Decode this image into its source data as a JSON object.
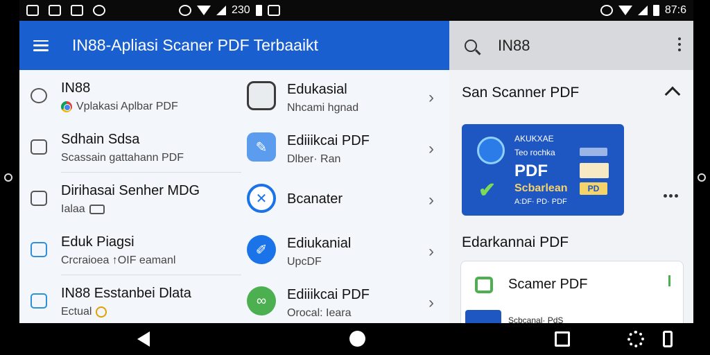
{
  "status_bar": {
    "center_time": "230",
    "right_time": "87:6"
  },
  "app_bar": {
    "title": "IN88-Apliasi Scaner PDF Terbaaikt"
  },
  "left_list": [
    {
      "title": "IN88",
      "subtitle": "Vplakasi Aplbar PDF",
      "icon": "refresh-icon"
    },
    {
      "title": "Sdhain Sdsa",
      "subtitle": "Scassain gattahann PDF",
      "icon": "scan-frame-icon"
    },
    {
      "title": "Dirihasai Senher MDG",
      "subtitle": "Ialaa",
      "icon": "photo-scan-icon"
    },
    {
      "title": "Eduk Piagsi",
      "subtitle": "Crcraioea ↑OIF eamanl",
      "icon": "building-icon"
    },
    {
      "title": "IN88 Esstanbei Dlata",
      "subtitle": "Ectual",
      "icon": "bank-icon"
    }
  ],
  "right_list": [
    {
      "title": "Edukasial",
      "subtitle": "Nhcami hgnad",
      "icon": "document-icon",
      "color": "#3a3a3a"
    },
    {
      "title": "Ediiikcai PDF",
      "subtitle": "Dlber· Ran",
      "icon": "edit-icon",
      "color": "#4a8fe8"
    },
    {
      "title": "Bcanater",
      "subtitle": "",
      "icon": "compass-icon",
      "color": "#1a73e8"
    },
    {
      "title": "Ediukanial",
      "subtitle": "UpcDF",
      "icon": "pen-icon",
      "color": "#1a73e8"
    },
    {
      "title": "Ediiikcai PDF",
      "subtitle": "Orocal: Ieara",
      "icon": "link-icon",
      "color": "#4caf50"
    }
  ],
  "side_panel": {
    "search_title": "IN88",
    "section_title": "San Scanner PDF",
    "card": {
      "line1": "AKUKXAE",
      "line2": "Teo rochka",
      "big": "PDF",
      "accent": "Scbarlean",
      "footer": "A:DF· PD· PDF",
      "tag": "PD"
    },
    "section2_title": "Edarkannai PDF",
    "card2": {
      "title": "Scamer PDF",
      "subtitle": "Scbcanal· PdS"
    }
  },
  "colors": {
    "primary": "#1a5fd0",
    "accent_green": "#4caf50",
    "accent_gold": "#f5d36b"
  }
}
